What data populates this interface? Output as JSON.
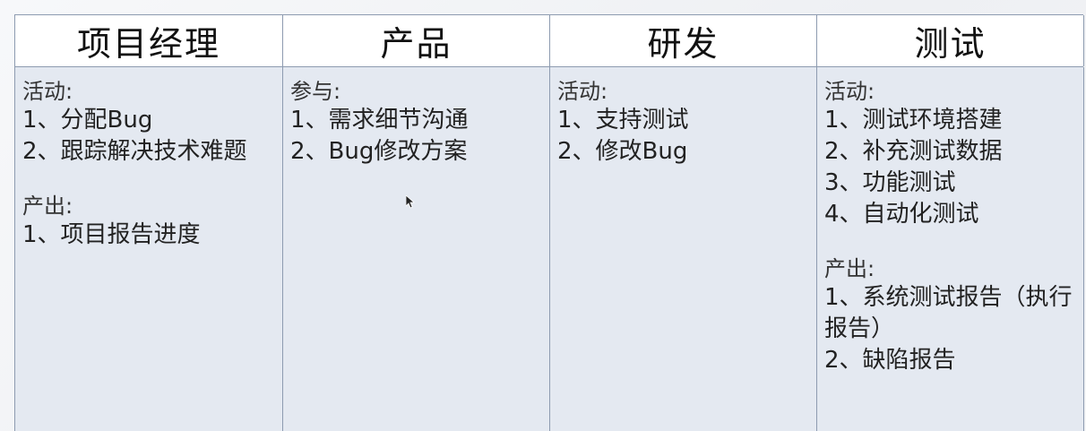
{
  "table": {
    "headers": [
      "项目经理",
      "产品",
      "研发",
      "测试"
    ],
    "columns": [
      {
        "sections": [
          {
            "title": "活动:",
            "items": [
              "1、分配Bug",
              "2、跟踪解决技术难题"
            ]
          },
          {
            "title": "产出:",
            "items": [
              "1、项目报告进度"
            ]
          }
        ]
      },
      {
        "sections": [
          {
            "title": "参与:",
            "items": [
              "1、需求细节沟通",
              "2、Bug修改方案"
            ]
          }
        ]
      },
      {
        "sections": [
          {
            "title": "活动:",
            "items": [
              "1、支持测试",
              "2、修改Bug"
            ]
          }
        ]
      },
      {
        "sections": [
          {
            "title": "活动:",
            "items": [
              "1、测试环境搭建",
              "2、补充测试数据",
              "3、功能测试",
              "4、自动化测试"
            ]
          },
          {
            "title": "产出:",
            "items": [
              "1、系统测试报告（执行报告）",
              "2、缺陷报告"
            ]
          }
        ]
      }
    ]
  },
  "colors": {
    "header_bg": "#ffffff",
    "body_bg": "#e4e9f1",
    "border": "#8d9bb0"
  }
}
